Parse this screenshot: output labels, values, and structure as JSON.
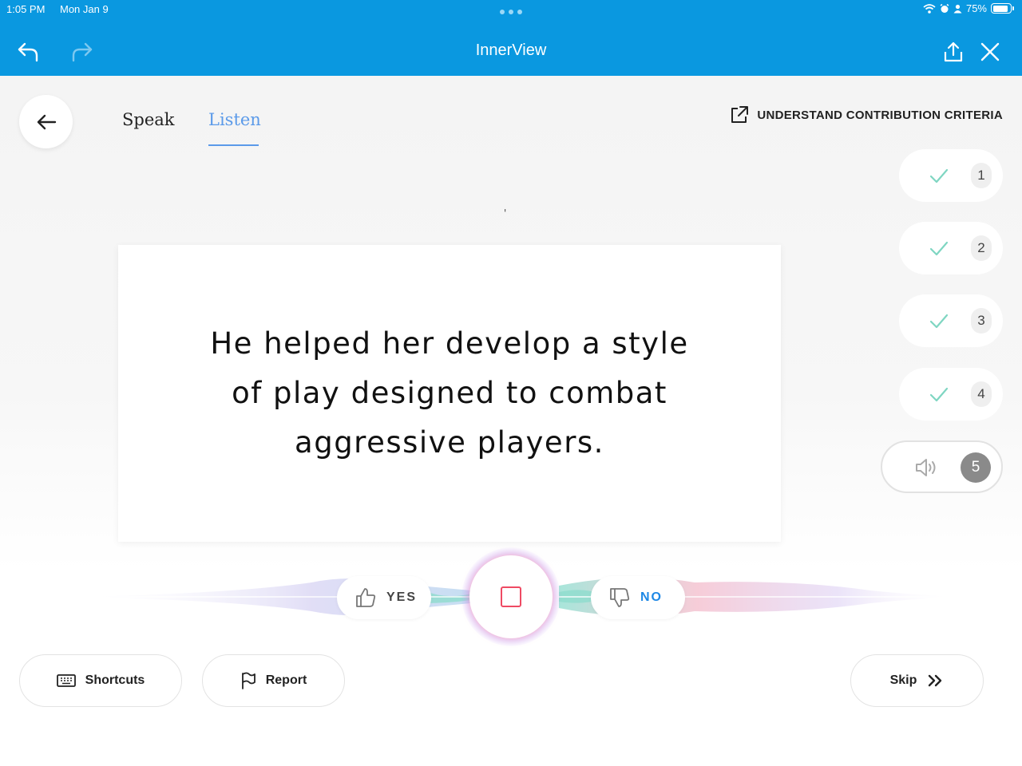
{
  "status_bar": {
    "time": "1:05 PM",
    "date": "Mon Jan 9",
    "battery_text": "75%",
    "battery_level": 75
  },
  "app_bar": {
    "title": "InnerView",
    "icons": [
      "undo-icon",
      "redo-icon",
      "share-icon",
      "close-icon"
    ]
  },
  "tabs": [
    {
      "label": "Speak",
      "active": false
    },
    {
      "label": "Listen",
      "active": true
    }
  ],
  "criteria_link": {
    "label": "UNDERSTAND CONTRIBUTION CRITERIA",
    "icon": "external-link-icon"
  },
  "stray_mark": "'",
  "sentence": {
    "lines": [
      "He helped her develop a style",
      "of play designed to combat",
      "aggressive players."
    ]
  },
  "progress": [
    {
      "number": "1",
      "state": "done"
    },
    {
      "number": "2",
      "state": "done"
    },
    {
      "number": "3",
      "state": "done"
    },
    {
      "number": "4",
      "state": "done"
    },
    {
      "number": "5",
      "state": "active"
    }
  ],
  "controls": {
    "yes_label": "YES",
    "no_label": "NO"
  },
  "bottom": {
    "shortcuts_label": "Shortcuts",
    "report_label": "Report",
    "skip_label": "Skip"
  },
  "colors": {
    "app_bar": "#0a98e0",
    "tab_active": "#5b9ae9",
    "check": "#7fd6c2",
    "record": "#ef4a63",
    "no_label": "#1e88e5"
  }
}
